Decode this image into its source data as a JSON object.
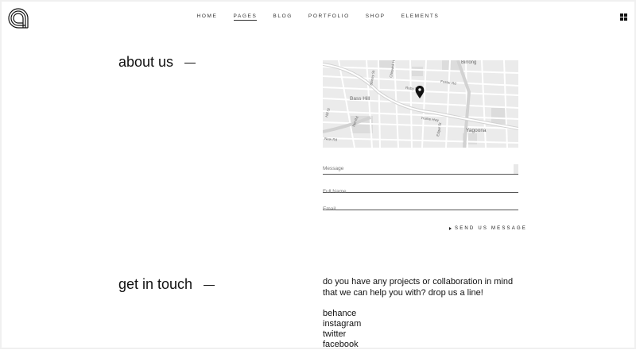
{
  "brand": {
    "logo_icon": "concentric-arcs-logo"
  },
  "nav": {
    "items": [
      {
        "label": "HOME",
        "active": false
      },
      {
        "label": "PAGES",
        "active": true
      },
      {
        "label": "BLOG",
        "active": false
      },
      {
        "label": "PORTFOLIO",
        "active": false
      },
      {
        "label": "SHOP",
        "active": false
      },
      {
        "label": "ELEMENTS",
        "active": false
      }
    ],
    "menu_icon": "grid-icon"
  },
  "about": {
    "title": "about us"
  },
  "map": {
    "labels": {
      "bass_hill": "Bass Hill",
      "yagoona": "Yagoona",
      "birrong": "Birrong",
      "hume_hwy": "Hume Hwy",
      "edgar_st": "Edgar St",
      "foster_rd": "Foster Rd",
      "ruby_st": "Ruby St",
      "nel_rd": "Nel Rd",
      "new_rd": "New Rd",
      "stacey_st": "Stacey St",
      "chiswick_hill_rd": "Chiswick Hill Rd",
      "hill_st": "Hill St"
    },
    "marker_icon": "map-pin-icon"
  },
  "form": {
    "message_placeholder": "Message",
    "fullname_placeholder": "Full Name",
    "email_placeholder": "Email",
    "send_label": "SEND US MESSAGE"
  },
  "contact": {
    "title": "get in touch",
    "line1": "do you have any projects or collaboration in mind",
    "line2": "that we can help you with? drop us a line!",
    "social": [
      "behance",
      "instagram",
      "twitter",
      "facebook"
    ]
  }
}
